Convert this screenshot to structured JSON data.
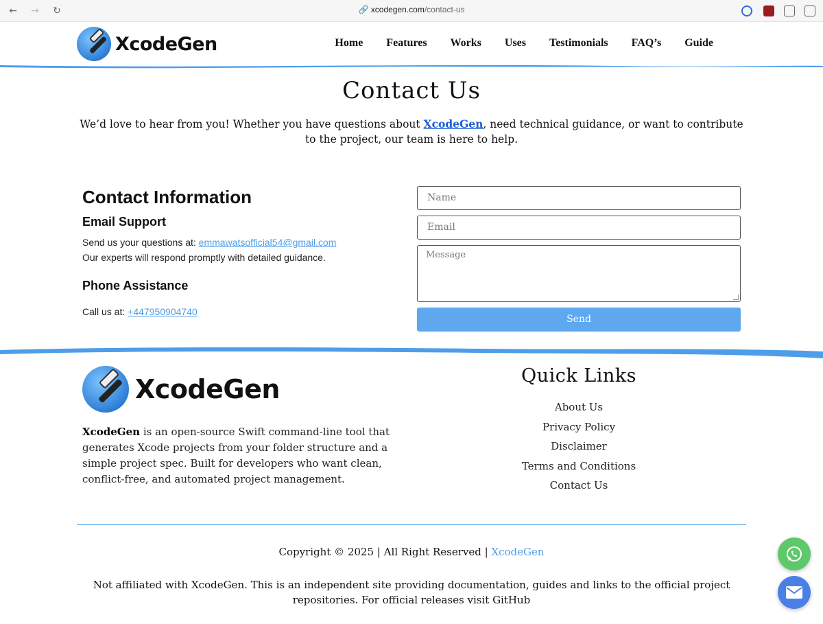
{
  "browser": {
    "url_domain": "xcodegen.com",
    "url_path": "/contact-us"
  },
  "header": {
    "logo_text": "XcodeGen",
    "nav": [
      "Home",
      "Features",
      "Works",
      "Uses",
      "Testimonials",
      "FAQ’s",
      "Guide"
    ]
  },
  "main": {
    "title": "Contact Us",
    "intro_before": "We’d love to hear from you! Whether you have questions about ",
    "intro_link": "XcodeGen",
    "intro_after": ", need technical guidance, or want to contribute to the project, our team is here to help."
  },
  "contact_info": {
    "heading": "Contact Information",
    "email_heading": "Email Support",
    "email_prefix": "Send us your questions at: ",
    "email": "emmawatsofficial54@gmail.com",
    "email_note": "Our experts will respond promptly with detailed guidance.",
    "phone_heading": "Phone Assistance",
    "phone_prefix": "Call us at: ",
    "phone": "+447950904740"
  },
  "form": {
    "name_placeholder": "Name",
    "email_placeholder": "Email",
    "message_placeholder": "Message",
    "send_label": "Send"
  },
  "footer": {
    "logo_text": "XcodeGen",
    "desc_bold": "XcodeGen",
    "desc_rest": " is an open-source Swift command-line tool that generates Xcode projects from your folder structure and a simple project spec. Built for developers who want clean, conflict-free, and automated project management.",
    "quick_links_heading": "Quick Links",
    "quick_links": [
      "About Us",
      "Privacy Policy",
      "Disclaimer",
      "Terms and Conditions",
      "Contact Us"
    ],
    "copyright_prefix": "Copyright © 2025 | All Right Reserved | ",
    "copyright_link": "XcodeGen",
    "disclaimer": "Not affiliated with XcodeGen. This is an independent site providing documentation, guides and links to the official project repositories. For official releases visit GitHub"
  },
  "colors": {
    "accent_blue": "#4f9de8",
    "send_button": "#5ea8f0",
    "whatsapp": "#5fc86a",
    "mail": "#4a7fe6"
  }
}
